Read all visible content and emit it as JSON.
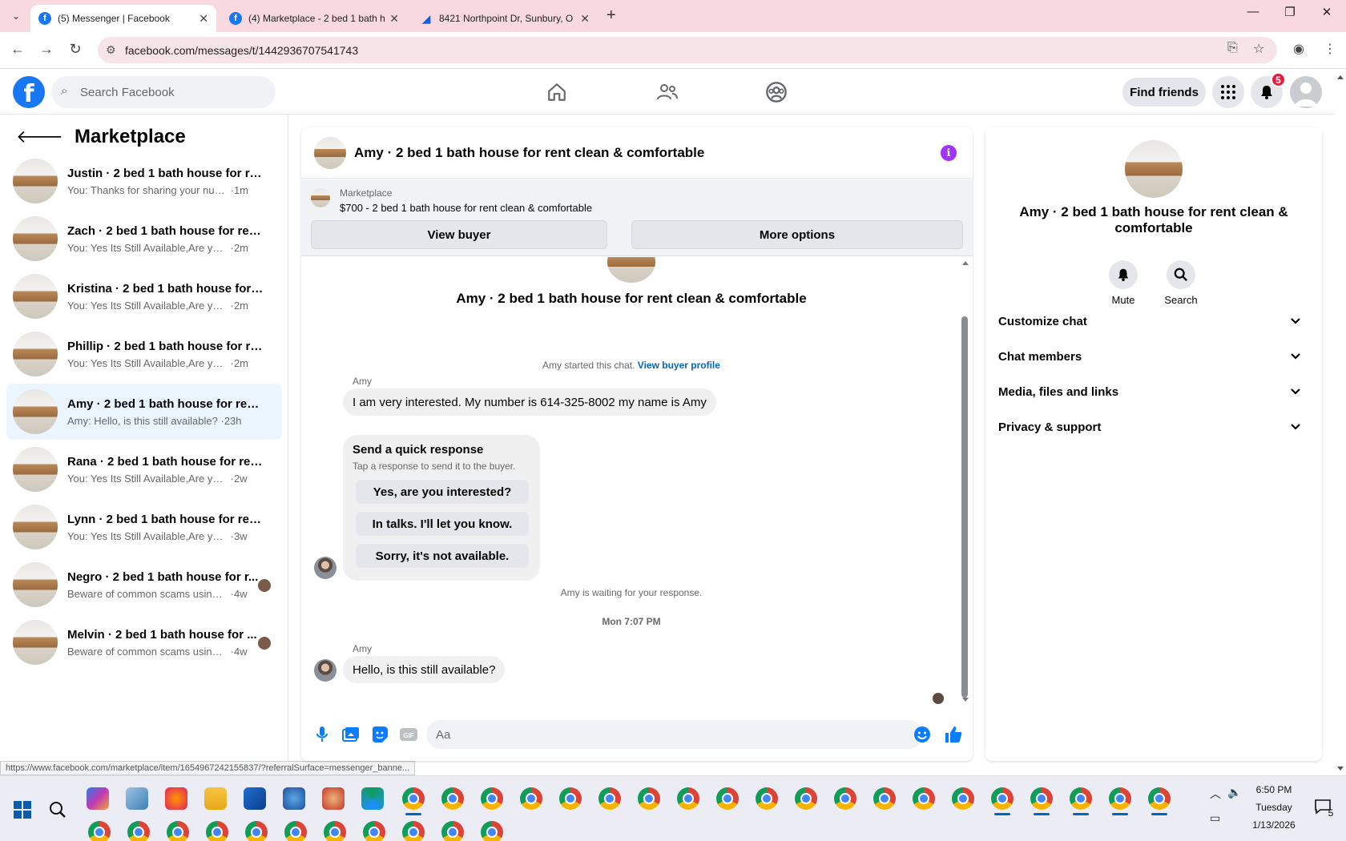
{
  "browser": {
    "tabs": [
      {
        "title": "(5) Messenger | Facebook",
        "favicon": "facebook-icon"
      },
      {
        "title": "(4) Marketplace - 2 bed 1 bath h",
        "favicon": "facebook-icon"
      },
      {
        "title": "8421 Northpoint Dr, Sunbury, O",
        "favicon": "zillow-icon"
      }
    ],
    "url": "facebook.com/messages/t/1442936707541743",
    "status_url": "https://www.facebook.com/marketplace/item/1654967242155837/?referralSurface=messenger_banne..."
  },
  "fb_header": {
    "search_placeholder": "Search Facebook",
    "find_friends": "Find friends",
    "notification_count": "5"
  },
  "sidebar": {
    "title": "Marketplace",
    "conversations": [
      {
        "name": "Justin · 2 bed 1 bath house for rent...",
        "preview": "You: Thanks for sharing your number",
        "time": "1m"
      },
      {
        "name": "Zach · 2 bed 1 bath house for rent ...",
        "preview": "You: Yes Its Still Available,Are you intr...",
        "time": "2m"
      },
      {
        "name": "Kristina · 2 bed 1 bath house for re...",
        "preview": "You: Yes Its Still Available,Are you intr...",
        "time": "2m"
      },
      {
        "name": "Phillip · 2 bed 1 bath house for ren...",
        "preview": "You: Yes Its Still Available,Are you intr...",
        "time": "2m"
      },
      {
        "name": "Amy · 2 bed 1 bath house for rent ...",
        "preview": "Amy: Hello, is this still available?",
        "time": "23h"
      },
      {
        "name": "Rana · 2 bed 1 bath house for rent ...",
        "preview": "You: Yes Its Still Available,Are you intr...",
        "time": "2w"
      },
      {
        "name": "Lynn · 2 bed 1 bath house for rent ...",
        "preview": "You: Yes Its Still Available,Are you intr...",
        "time": "3w"
      },
      {
        "name": "Negro · 2 bed 1 bath house for r...",
        "preview": "Beware of common scams using p...",
        "time": "4w"
      },
      {
        "name": "Melvin · 2 bed 1 bath house for ...",
        "preview": "Beware of common scams using p...",
        "time": "4w"
      }
    ]
  },
  "chat": {
    "title": "Amy · 2 bed 1 bath house for rent clean & comfortable",
    "marketplace_label": "Marketplace",
    "listing": "$700 - 2 bed 1 bath house for rent clean & comfortable",
    "view_buyer": "View buyer",
    "more_options": "More options",
    "big_name": "Amy · 2 bed 1 bath house for rent clean & comfortable",
    "started_text": "Amy started this chat.",
    "view_buyer_profile": "View buyer profile",
    "sender1": "Amy",
    "msg1": "I am very interested. My number is 614-325-8002 my name is Amy",
    "quick_title": "Send a quick response",
    "quick_sub": "Tap a response to send it to the buyer.",
    "quick_replies": [
      "Yes, are you interested?",
      "In talks. I'll let you know.",
      "Sorry, it's not available."
    ],
    "waiting": "Amy is waiting for your response.",
    "timestamp": "Mon 7:07 PM",
    "sender2": "Amy",
    "msg2": "Hello, is this still available?",
    "input_placeholder": "Aa"
  },
  "info_panel": {
    "name": "Amy · 2 bed 1 bath house for rent clean & comfortable",
    "mute": "Mute",
    "search": "Search",
    "sections": [
      "Customize chat",
      "Chat members",
      "Media, files and links",
      "Privacy & support"
    ]
  },
  "taskbar": {
    "time": "6:50 PM",
    "day": "Tuesday",
    "date": "1/13/2026",
    "notifications": "5"
  },
  "colors": {
    "fb_blue": "#1877f2",
    "messenger_purple": "#a033ff",
    "active_conv": "#ebf5ff",
    "tabstrip": "#f9d9e0"
  }
}
